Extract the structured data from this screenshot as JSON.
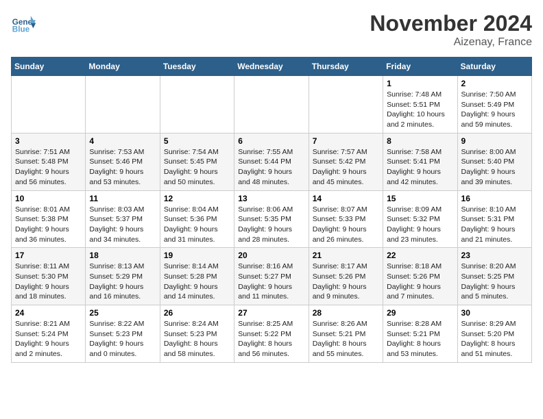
{
  "header": {
    "logo_line1": "General",
    "logo_line2": "Blue",
    "month": "November 2024",
    "location": "Aizenay, France"
  },
  "days_of_week": [
    "Sunday",
    "Monday",
    "Tuesday",
    "Wednesday",
    "Thursday",
    "Friday",
    "Saturday"
  ],
  "weeks": [
    [
      {
        "day": "",
        "info": ""
      },
      {
        "day": "",
        "info": ""
      },
      {
        "day": "",
        "info": ""
      },
      {
        "day": "",
        "info": ""
      },
      {
        "day": "",
        "info": ""
      },
      {
        "day": "1",
        "info": "Sunrise: 7:48 AM\nSunset: 5:51 PM\nDaylight: 10 hours and 2 minutes."
      },
      {
        "day": "2",
        "info": "Sunrise: 7:50 AM\nSunset: 5:49 PM\nDaylight: 9 hours and 59 minutes."
      }
    ],
    [
      {
        "day": "3",
        "info": "Sunrise: 7:51 AM\nSunset: 5:48 PM\nDaylight: 9 hours and 56 minutes."
      },
      {
        "day": "4",
        "info": "Sunrise: 7:53 AM\nSunset: 5:46 PM\nDaylight: 9 hours and 53 minutes."
      },
      {
        "day": "5",
        "info": "Sunrise: 7:54 AM\nSunset: 5:45 PM\nDaylight: 9 hours and 50 minutes."
      },
      {
        "day": "6",
        "info": "Sunrise: 7:55 AM\nSunset: 5:44 PM\nDaylight: 9 hours and 48 minutes."
      },
      {
        "day": "7",
        "info": "Sunrise: 7:57 AM\nSunset: 5:42 PM\nDaylight: 9 hours and 45 minutes."
      },
      {
        "day": "8",
        "info": "Sunrise: 7:58 AM\nSunset: 5:41 PM\nDaylight: 9 hours and 42 minutes."
      },
      {
        "day": "9",
        "info": "Sunrise: 8:00 AM\nSunset: 5:40 PM\nDaylight: 9 hours and 39 minutes."
      }
    ],
    [
      {
        "day": "10",
        "info": "Sunrise: 8:01 AM\nSunset: 5:38 PM\nDaylight: 9 hours and 36 minutes."
      },
      {
        "day": "11",
        "info": "Sunrise: 8:03 AM\nSunset: 5:37 PM\nDaylight: 9 hours and 34 minutes."
      },
      {
        "day": "12",
        "info": "Sunrise: 8:04 AM\nSunset: 5:36 PM\nDaylight: 9 hours and 31 minutes."
      },
      {
        "day": "13",
        "info": "Sunrise: 8:06 AM\nSunset: 5:35 PM\nDaylight: 9 hours and 28 minutes."
      },
      {
        "day": "14",
        "info": "Sunrise: 8:07 AM\nSunset: 5:33 PM\nDaylight: 9 hours and 26 minutes."
      },
      {
        "day": "15",
        "info": "Sunrise: 8:09 AM\nSunset: 5:32 PM\nDaylight: 9 hours and 23 minutes."
      },
      {
        "day": "16",
        "info": "Sunrise: 8:10 AM\nSunset: 5:31 PM\nDaylight: 9 hours and 21 minutes."
      }
    ],
    [
      {
        "day": "17",
        "info": "Sunrise: 8:11 AM\nSunset: 5:30 PM\nDaylight: 9 hours and 18 minutes."
      },
      {
        "day": "18",
        "info": "Sunrise: 8:13 AM\nSunset: 5:29 PM\nDaylight: 9 hours and 16 minutes."
      },
      {
        "day": "19",
        "info": "Sunrise: 8:14 AM\nSunset: 5:28 PM\nDaylight: 9 hours and 14 minutes."
      },
      {
        "day": "20",
        "info": "Sunrise: 8:16 AM\nSunset: 5:27 PM\nDaylight: 9 hours and 11 minutes."
      },
      {
        "day": "21",
        "info": "Sunrise: 8:17 AM\nSunset: 5:26 PM\nDaylight: 9 hours and 9 minutes."
      },
      {
        "day": "22",
        "info": "Sunrise: 8:18 AM\nSunset: 5:26 PM\nDaylight: 9 hours and 7 minutes."
      },
      {
        "day": "23",
        "info": "Sunrise: 8:20 AM\nSunset: 5:25 PM\nDaylight: 9 hours and 5 minutes."
      }
    ],
    [
      {
        "day": "24",
        "info": "Sunrise: 8:21 AM\nSunset: 5:24 PM\nDaylight: 9 hours and 2 minutes."
      },
      {
        "day": "25",
        "info": "Sunrise: 8:22 AM\nSunset: 5:23 PM\nDaylight: 9 hours and 0 minutes."
      },
      {
        "day": "26",
        "info": "Sunrise: 8:24 AM\nSunset: 5:23 PM\nDaylight: 8 hours and 58 minutes."
      },
      {
        "day": "27",
        "info": "Sunrise: 8:25 AM\nSunset: 5:22 PM\nDaylight: 8 hours and 56 minutes."
      },
      {
        "day": "28",
        "info": "Sunrise: 8:26 AM\nSunset: 5:21 PM\nDaylight: 8 hours and 55 minutes."
      },
      {
        "day": "29",
        "info": "Sunrise: 8:28 AM\nSunset: 5:21 PM\nDaylight: 8 hours and 53 minutes."
      },
      {
        "day": "30",
        "info": "Sunrise: 8:29 AM\nSunset: 5:20 PM\nDaylight: 8 hours and 51 minutes."
      }
    ]
  ]
}
